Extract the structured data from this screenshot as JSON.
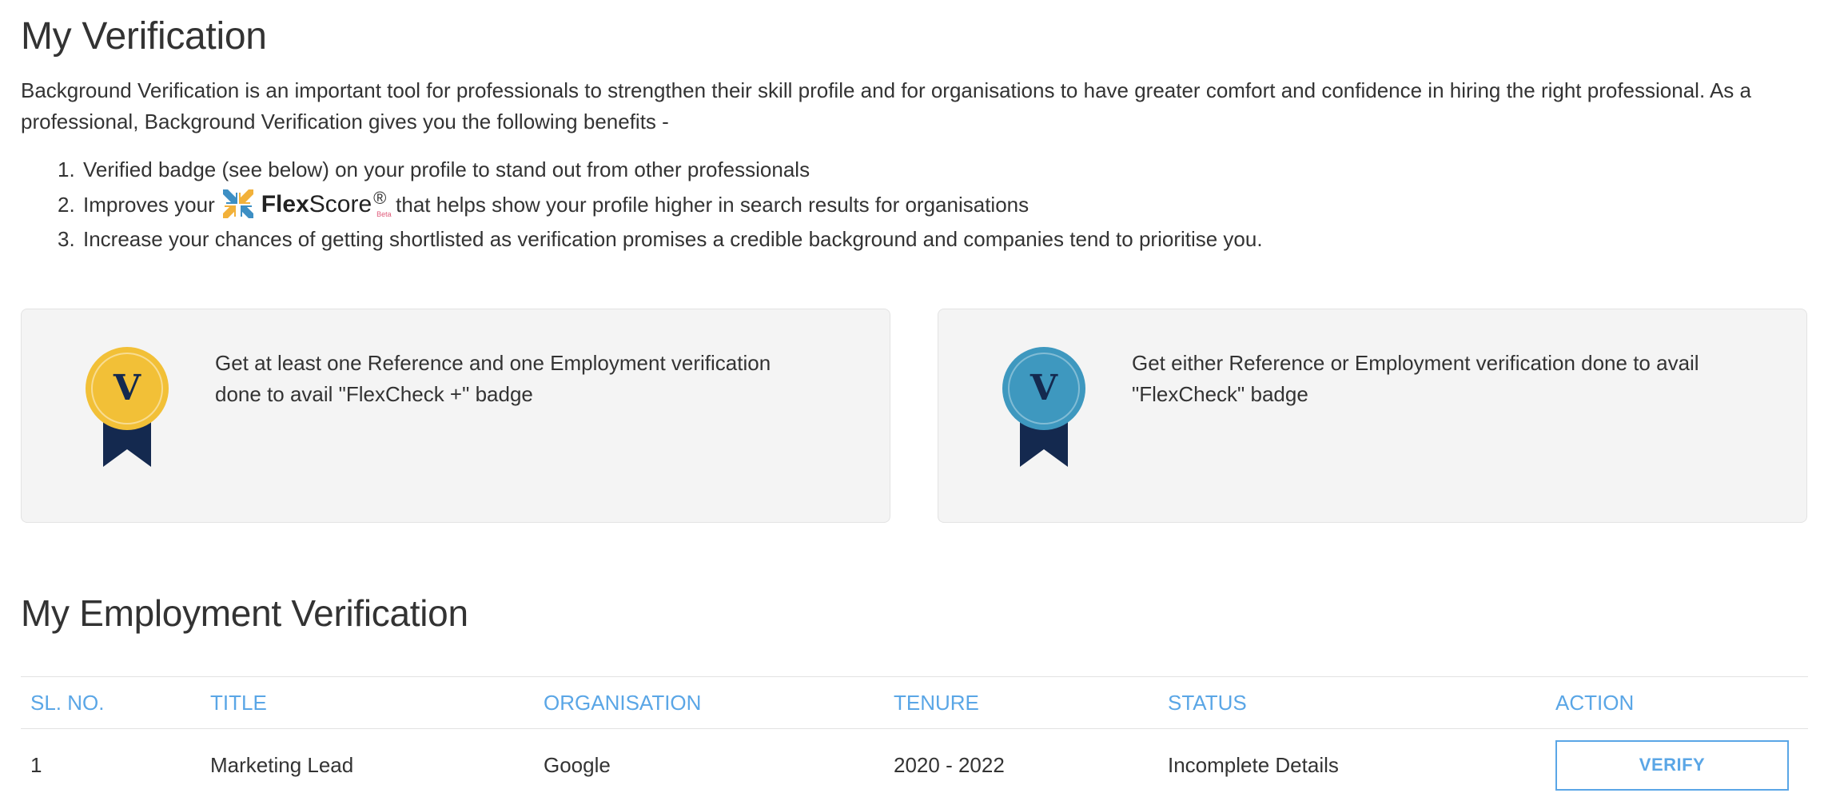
{
  "page_title": "My Verification",
  "intro": "Background Verification is an important tool for professionals to strengthen their skill profile and for organisations to have greater comfort and confidence in hiring the right professional. As a professional, Background Verification gives you the following benefits -",
  "benefits": [
    {
      "num": "1.",
      "text": "Verified badge (see below) on your profile to stand out from other professionals"
    },
    {
      "num": "2.",
      "before": "Improves your",
      "after": "that helps show your profile higher in search results for organisations"
    },
    {
      "num": "3.",
      "text": "Increase your chances of getting shortlisted as verification promises a credible background and companies tend to prioritise you."
    }
  ],
  "flexscore": {
    "flex": "Flex",
    "score": "Score",
    "reg": "®",
    "beta": "Beta"
  },
  "cards": [
    {
      "badge_letter": "V",
      "badge_color": "#f2c037",
      "text": "Get at least one Reference and one Employment verification done to avail \"FlexCheck +\" badge"
    },
    {
      "badge_letter": "V",
      "badge_color": "#3e98bf",
      "text": "Get either Reference or Employment verification done to avail \"FlexCheck\" badge"
    }
  ],
  "employment_title": "My Employment Verification",
  "table": {
    "headers": [
      "SL. NO.",
      "TITLE",
      "ORGANISATION",
      "TENURE",
      "STATUS",
      "ACTION"
    ],
    "rows": [
      {
        "sl": "1",
        "title": "Marketing Lead",
        "organisation": "Google",
        "tenure": "2020 - 2022",
        "status": "Incomplete Details",
        "action": "VERIFY"
      }
    ]
  },
  "colors": {
    "accent": "#5aa6e6",
    "ribbon": "#14294f"
  }
}
